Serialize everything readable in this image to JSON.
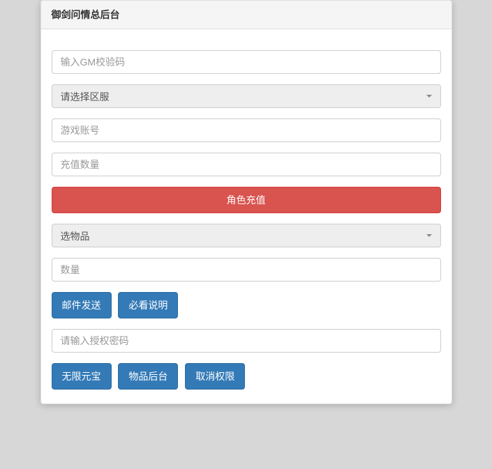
{
  "panel": {
    "title": "御剑问情总后台"
  },
  "inputs": {
    "gm_code_placeholder": "输入GM校验码",
    "server_select_text": "请选择区服",
    "game_account_placeholder": "游戏账号",
    "recharge_amount_placeholder": "充值数量",
    "item_select_text": "选物品",
    "quantity_placeholder": "数量",
    "auth_password_placeholder": "请输入授权密码"
  },
  "buttons": {
    "role_recharge": "角色充值",
    "send_mail": "邮件发送",
    "must_read": "必看说明",
    "unlimited_gold": "无限元宝",
    "item_backend": "物品后台",
    "cancel_permission": "取消权限"
  }
}
